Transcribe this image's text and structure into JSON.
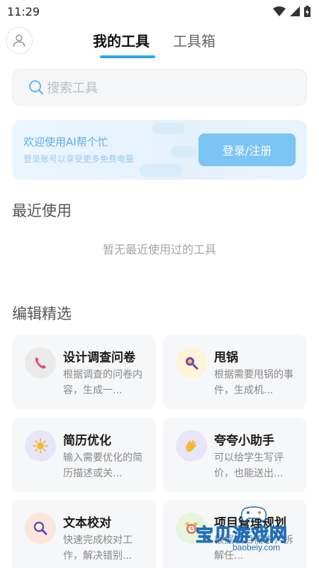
{
  "status": {
    "time": "11:29"
  },
  "tabs": [
    {
      "label": "我的工具",
      "active": true
    },
    {
      "label": "工具箱",
      "active": false
    }
  ],
  "search": {
    "placeholder": "搜索工具"
  },
  "banner": {
    "title": "欢迎使用AI帮个忙",
    "subtitle": "登录账号以享受更多免费电量",
    "button_label": "登录/注册"
  },
  "recent": {
    "title": "最近使用",
    "empty_text": "暂无最近使用过的工具"
  },
  "featured": {
    "title": "编辑精选",
    "cards": [
      {
        "title": "设计调查问卷",
        "desc": "根据调查的问卷内容，生成一...",
        "icon": "phone-icon",
        "icon_bg": "#eaeaea"
      },
      {
        "title": "甩锅",
        "desc": "根据需要甩锅的事件，生成机...",
        "icon": "pan-icon",
        "icon_bg": "#fdf3d6"
      },
      {
        "title": "简历优化",
        "desc": "输入需要优化的简历描述或关...",
        "icon": "sun-icon",
        "icon_bg": "#e6e6f8"
      },
      {
        "title": "夸夸小助手",
        "desc": "可以给学生写评价，也能送出...",
        "icon": "clap-icon",
        "icon_bg": "#e7e6f7"
      },
      {
        "title": "文本校对",
        "desc": "快速完成校对工作，解决错别...",
        "icon": "magnifier-icon",
        "icon_bg": "#fde6dc"
      },
      {
        "title": "项目管理规划",
        "desc": "根据项目需求，拆解任...",
        "icon": "alarm-clock-icon",
        "icon_bg": "#e7f4de"
      }
    ]
  },
  "watermark": {
    "text": "宝贝游戏网",
    "url": "baobeiy.com"
  },
  "colors": {
    "accent": "#2ea7f0",
    "login_button": "#7cc4f3"
  }
}
